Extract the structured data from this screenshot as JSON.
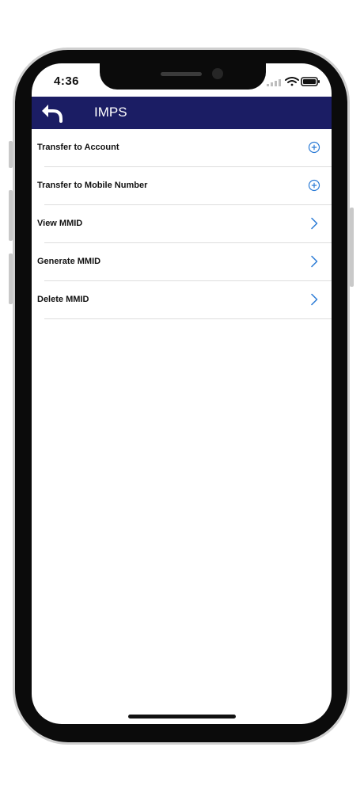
{
  "status_bar": {
    "time": "4:36",
    "icons": [
      "signal-icon",
      "wifi-icon",
      "battery-icon"
    ]
  },
  "header": {
    "title": "IMPS",
    "back_icon": "back-arrow-icon",
    "background_color": "#1b1d64"
  },
  "menu": {
    "items": [
      {
        "label": "Transfer to Account",
        "icon": "plus-circle-icon"
      },
      {
        "label": "Transfer to Mobile Number",
        "icon": "plus-circle-icon"
      },
      {
        "label": "View MMID",
        "icon": "chevron-right-icon"
      },
      {
        "label": "Generate MMID",
        "icon": "chevron-right-icon"
      },
      {
        "label": "Delete MMID",
        "icon": "chevron-right-icon"
      }
    ],
    "icon_color": "#2b7bd6"
  }
}
